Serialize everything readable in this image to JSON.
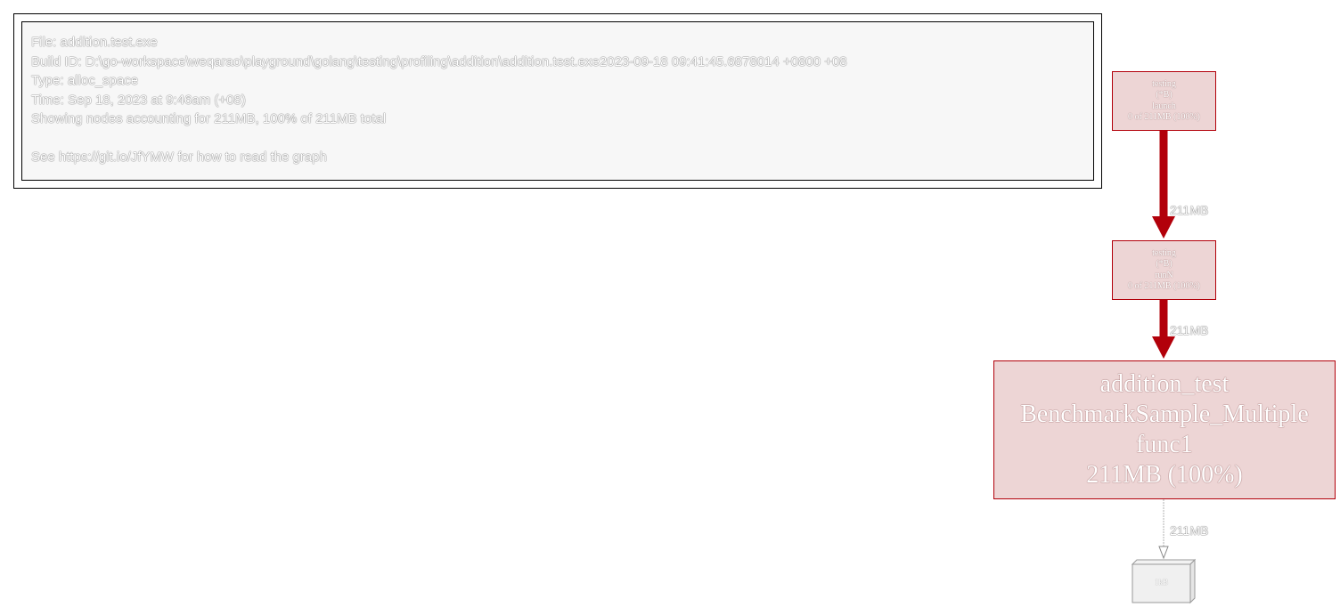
{
  "legend": {
    "lines": [
      "File: addition.test.exe",
      "Build ID: D:\\go-workspace\\weqarao\\playground\\golang\\testing\\profiling\\addition\\addition.test.exe2023-09-18 09:41:45.6878014 +0800 +08",
      "Type: alloc_space",
      "Time: Sep 18, 2023 at 9:46am (+08)",
      "Showing nodes accounting for 211MB, 100% of 211MB total",
      "",
      "See https://git.io/JfYMW for how to read the graph"
    ]
  },
  "nodes": {
    "launch": {
      "lines": [
        "testing",
        "(*B)",
        "launch",
        "0 of 211MB (100%)"
      ]
    },
    "runN": {
      "lines": [
        "testing",
        "(*B)",
        "runN",
        "0 of 211MB (100%)"
      ]
    },
    "func1": {
      "lines": [
        "addition_test",
        "BenchmarkSample_Multiple",
        "func1",
        "211MB (100%)"
      ]
    },
    "alloc": {
      "label": "1kB"
    }
  },
  "edges": {
    "launch_runN": "211MB",
    "runN_func1": "211MB",
    "func1_alloc": "211MB"
  },
  "colors": {
    "node_border": "#b2000a",
    "node_fill": "#edd5d5",
    "edge_heavy": "#b2000a",
    "edge_light": "#b2b2b2"
  }
}
